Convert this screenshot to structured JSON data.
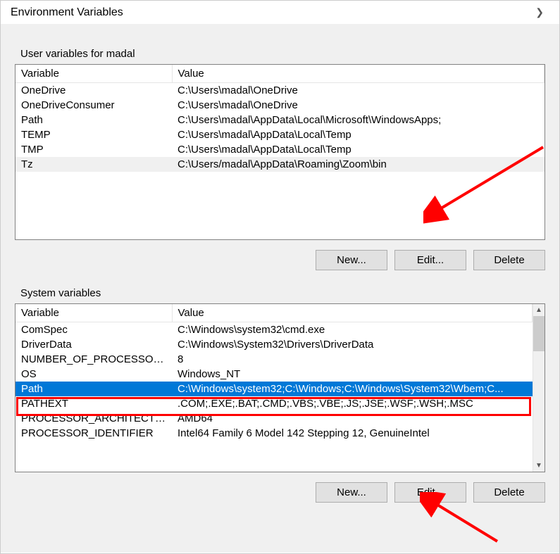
{
  "title": "Environment Variables",
  "user_section": {
    "label": "User variables for madal",
    "header_var": "Variable",
    "header_val": "Value",
    "rows": [
      {
        "var": "OneDrive",
        "val": "C:\\Users\\madal\\OneDrive"
      },
      {
        "var": "OneDriveConsumer",
        "val": "C:\\Users\\madal\\OneDrive"
      },
      {
        "var": "Path",
        "val": "C:\\Users\\madal\\AppData\\Local\\Microsoft\\WindowsApps;"
      },
      {
        "var": "TEMP",
        "val": "C:\\Users\\madal\\AppData\\Local\\Temp"
      },
      {
        "var": "TMP",
        "val": "C:\\Users\\madal\\AppData\\Local\\Temp"
      },
      {
        "var": "Tz",
        "val": "C:\\Users/madal\\AppData\\Roaming\\Zoom\\bin"
      }
    ],
    "buttons": {
      "new": "New...",
      "edit": "Edit...",
      "delete": "Delete"
    }
  },
  "system_section": {
    "label": "System variables",
    "header_var": "Variable",
    "header_val": "Value",
    "rows": [
      {
        "var": "ComSpec",
        "val": "C:\\Windows\\system32\\cmd.exe"
      },
      {
        "var": "DriverData",
        "val": "C:\\Windows\\System32\\Drivers\\DriverData"
      },
      {
        "var": "NUMBER_OF_PROCESSORS",
        "val": "8"
      },
      {
        "var": "OS",
        "val": "Windows_NT"
      },
      {
        "var": "Path",
        "val": "C:\\Windows\\system32;C:\\Windows;C:\\Windows\\System32\\Wbem;C..."
      },
      {
        "var": "PATHEXT",
        "val": ".COM;.EXE;.BAT;.CMD;.VBS;.VBE;.JS;.JSE;.WSF;.WSH;.MSC"
      },
      {
        "var": "PROCESSOR_ARCHITECTURE",
        "val": "AMD64"
      },
      {
        "var": "PROCESSOR_IDENTIFIER",
        "val": "Intel64 Family 6 Model 142 Stepping 12, GenuineIntel"
      }
    ],
    "buttons": {
      "new": "New...",
      "edit": "Edit...",
      "delete": "Delete"
    }
  }
}
